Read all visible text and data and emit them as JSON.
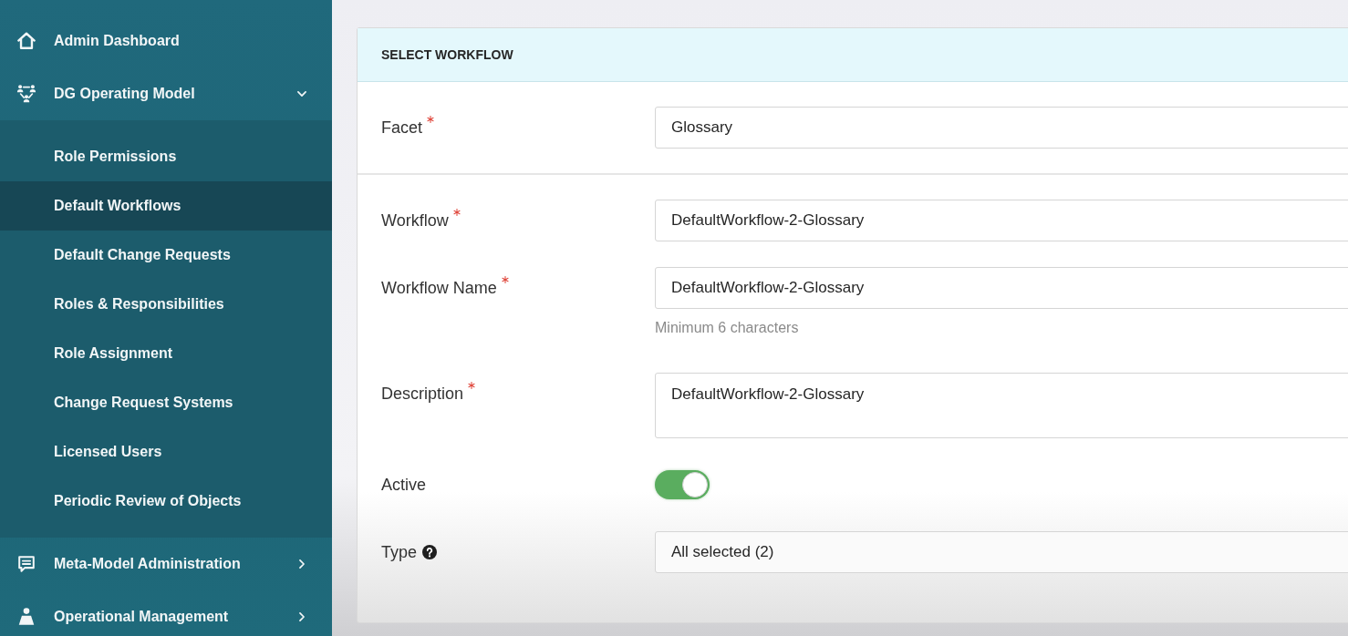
{
  "sidebar": {
    "items": [
      {
        "kind": "link",
        "label": "Admin Dashboard",
        "selected": false
      },
      {
        "kind": "group",
        "label": "DG Operating Model",
        "selected": false,
        "expanded": true,
        "children": [
          {
            "label": "Role Permissions",
            "selected": false
          },
          {
            "label": "Default Workflows",
            "selected": true
          },
          {
            "label": "Default Change Requests",
            "selected": false
          },
          {
            "label": "Roles & Responsibilities",
            "selected": false
          },
          {
            "label": "Role Assignment",
            "selected": false
          },
          {
            "label": "Change Request Systems",
            "selected": false
          },
          {
            "label": "Licensed Users",
            "selected": false
          },
          {
            "label": "Periodic Review of Objects",
            "selected": false
          }
        ]
      },
      {
        "kind": "group",
        "label": "Meta-Model Administration",
        "selected": false,
        "expanded": false
      },
      {
        "kind": "group",
        "label": "Operational Management",
        "selected": false,
        "expanded": false
      }
    ]
  },
  "form": {
    "title": "SELECT WORKFLOW",
    "sections": [
      {
        "fields": [
          {
            "kind": "select",
            "label": "Facet",
            "required": true,
            "value": "Glossary"
          }
        ]
      },
      {
        "fields": [
          {
            "kind": "text",
            "label": "Workflow",
            "required": true,
            "value": "DefaultWorkflow-2-Glossary"
          },
          {
            "kind": "text",
            "label": "Workflow Name",
            "required": true,
            "value": "DefaultWorkflow-2-Glossary",
            "hint": "Minimum 6 characters"
          },
          {
            "kind": "textarea",
            "label": "Description",
            "required": true,
            "value": "DefaultWorkflow-2-Glossary"
          },
          {
            "kind": "toggle",
            "label": "Active",
            "required": false,
            "on": true
          },
          {
            "kind": "multiselect",
            "label": "Type",
            "required": false,
            "help": true,
            "value": "All selected (2)"
          }
        ]
      }
    ]
  }
}
